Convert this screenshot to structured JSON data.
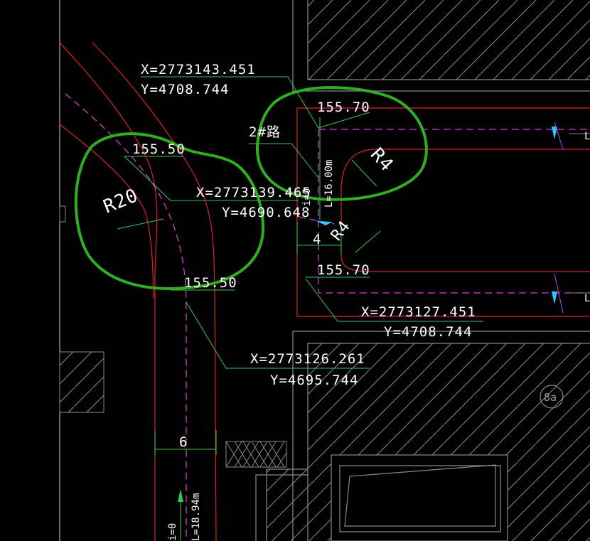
{
  "coordinates": [
    {
      "x": "X=2773143.451",
      "y": "Y=4708.744"
    },
    {
      "x": "X=2773139.465",
      "y": "Y=4690.648"
    },
    {
      "x": "X=2773127.451",
      "y": "Y=4708.744"
    },
    {
      "x": "X=2773126.261",
      "y": "Y=4695.744"
    }
  ],
  "elevations": {
    "top_left": "155.50",
    "top_right": "155.70",
    "bottom_left": "155.50",
    "bottom_right": "155.70"
  },
  "radii": {
    "large": "R20",
    "small_top": "R4",
    "small_bottom": "R4"
  },
  "road_label": "2#路",
  "widths": {
    "road_4": "4",
    "road_6": "6"
  },
  "vertical_labels": {
    "length_16": "L=16.00m",
    "slope_top": "i=0",
    "slope_bottom": "i=0",
    "length_bottom": "L=18.94m"
  },
  "building_tag": "8a",
  "edge_labels": [
    "L",
    "L"
  ],
  "colors": {
    "background": "#000000",
    "road_edge": "#e0202a",
    "centerline": "#d040d0",
    "dimension": "#34c759",
    "highlight": "#2fae22",
    "text": "#ffffff",
    "arrow": "#2fc8ff"
  }
}
